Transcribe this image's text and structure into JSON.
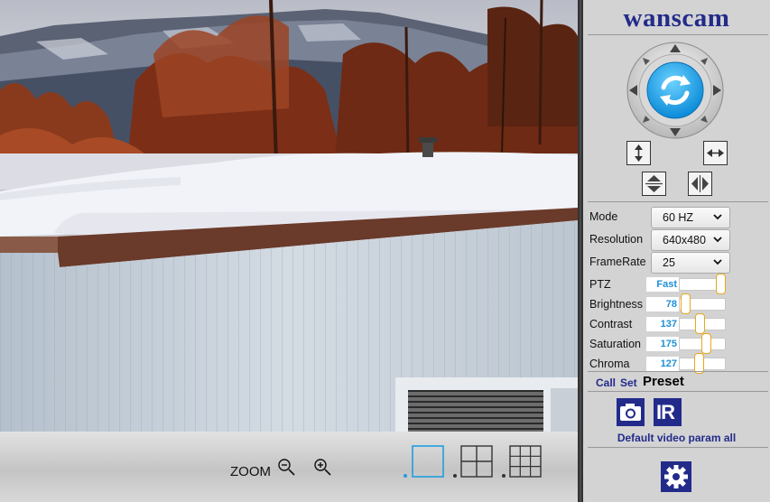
{
  "brand": "wanscam",
  "icons": {
    "ptz_center": "refresh-icon",
    "flip_vertical": "flip-vertical-icon",
    "flip_horizontal": "flip-horizontal-icon",
    "mirror_vertical": "mirror-vertical-icon",
    "mirror_horizontal": "mirror-horizontal-icon",
    "snapshot": "camera-icon",
    "ir": "ir-icon",
    "settings": "gear-icon",
    "zoom_out": "zoom-out-icon",
    "zoom_in": "zoom-in-icon",
    "layout_single": "single-view-icon",
    "layout_quad": "quad-view-icon",
    "layout_nine": "nine-view-icon"
  },
  "colors": {
    "brand": "#232b8a",
    "accent": "#1e8fd6",
    "knob_border": "#e8a81b",
    "active_layout": "#1e9ee0"
  },
  "bottom_bar": {
    "zoom_label": "ZOOM",
    "active_layout": "single"
  },
  "settings": {
    "mode": {
      "label": "Mode",
      "value": "60 HZ"
    },
    "resolution": {
      "label": "Resolution",
      "value": "640x480"
    },
    "framerate": {
      "label": "FrameRate",
      "value": "25"
    }
  },
  "sliders": {
    "ptz": {
      "label": "PTZ",
      "value": "Fast",
      "level": 1.0
    },
    "brightness": {
      "label": "Brightness",
      "value": "78",
      "level": 0.05
    },
    "contrast": {
      "label": "Contrast",
      "value": "137",
      "level": 0.45
    },
    "saturation": {
      "label": "Saturation",
      "value": "175",
      "level": 0.6
    },
    "chroma": {
      "label": "Chroma",
      "value": "127",
      "level": 0.42
    }
  },
  "preset": {
    "call": "Call",
    "set": "Set",
    "title": "Preset"
  },
  "ir_label": "IR",
  "default_link": "Default video param all"
}
